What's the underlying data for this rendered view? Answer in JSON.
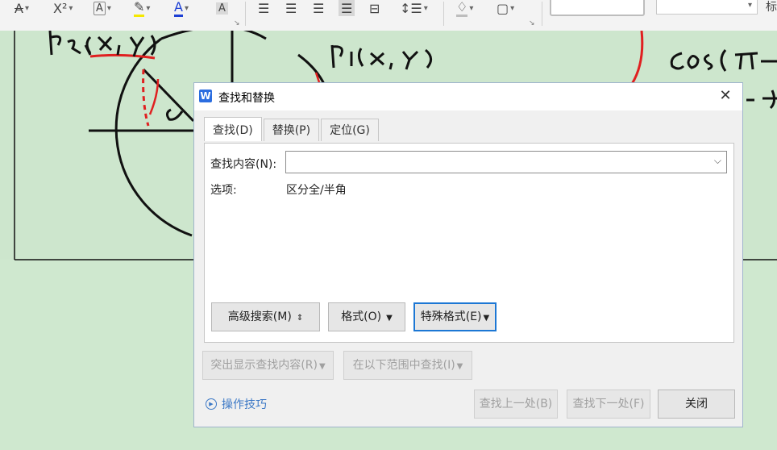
{
  "toolbar": {
    "superscript_label": "X²",
    "edge_text": "标"
  },
  "dialog": {
    "title": "查找和替换",
    "tabs": [
      {
        "label": "查找(D)"
      },
      {
        "label": "替换(P)"
      },
      {
        "label": "定位(G)"
      }
    ],
    "find_label": "查找内容(N):",
    "find_value": "",
    "options_label": "选项:",
    "options_value": "区分全/半角",
    "advanced_search": "高级搜索(M)",
    "format": "格式(O)",
    "special_format": "特殊格式(E)",
    "highlight_results": "突出显示查找内容(R)",
    "find_in_range": "在以下范围中查找(I)",
    "tips": "操作技巧",
    "find_prev": "查找上一处(B)",
    "find_next": "查找下一处(F)",
    "close": "关闭"
  },
  "colors": {
    "background": "#cfe8cf",
    "accent": "#1c77d4",
    "link": "#3b78c6",
    "ink_red": "#e02020"
  }
}
